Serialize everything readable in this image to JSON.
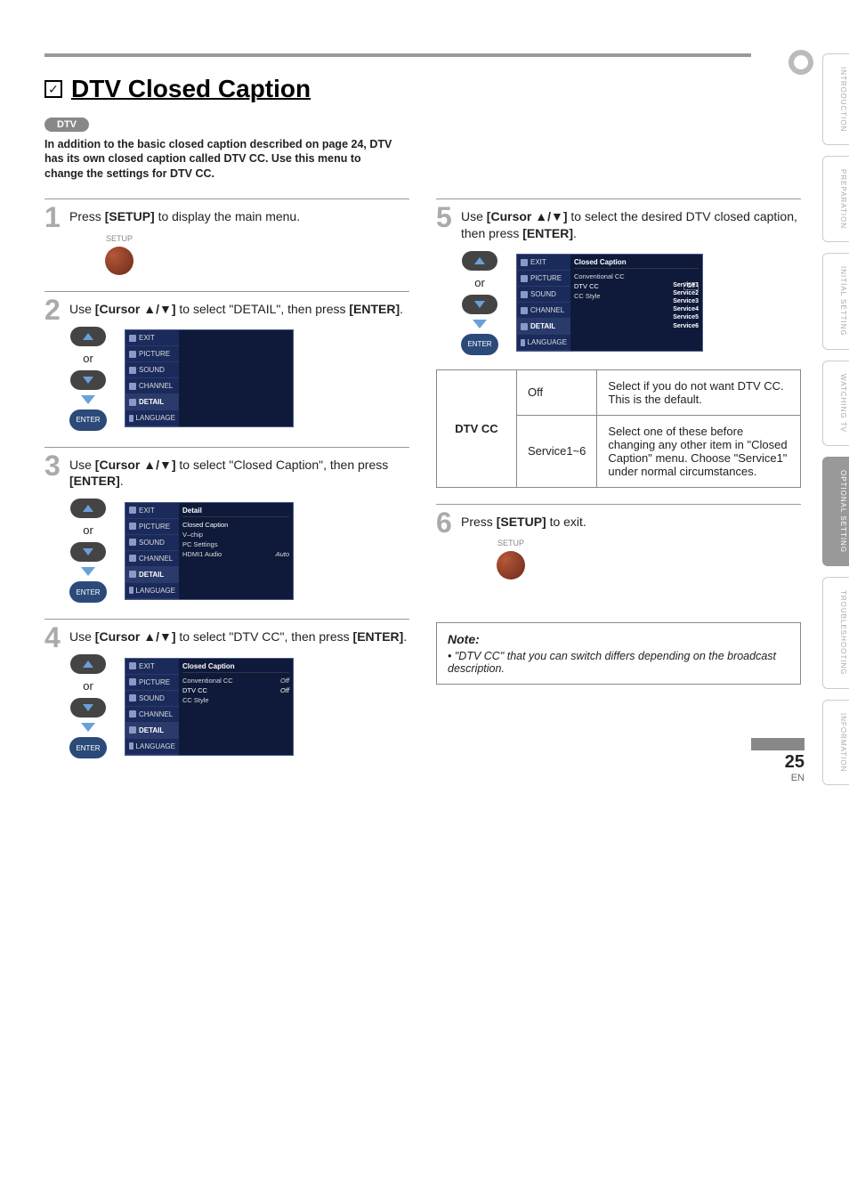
{
  "header": {
    "title": "DTV Closed Caption",
    "badge": "DTV",
    "intro": "In addition to the basic closed caption described on page 24, DTV has its own closed caption called DTV CC. Use this menu to change the settings for DTV CC."
  },
  "steps": {
    "s1": {
      "num": "1",
      "text_pre": "Press ",
      "text_bold": "[SETUP]",
      "text_post": " to display the main menu.",
      "setup_label": "SETUP"
    },
    "s2": {
      "num": "2",
      "text_pre": "Use ",
      "text_bold": "[Cursor ▲/▼]",
      "text_mid": " to select \"DETAIL\", then press ",
      "text_bold2": "[ENTER]",
      "text_end": ".",
      "or": "or",
      "enter": "ENTER"
    },
    "s3": {
      "num": "3",
      "text_pre": "Use ",
      "text_bold": "[Cursor ▲/▼]",
      "text_mid": " to select \"Closed Caption\", then press ",
      "text_bold2": "[ENTER]",
      "text_end": ".",
      "or": "or",
      "enter": "ENTER"
    },
    "s4": {
      "num": "4",
      "text_pre": "Use ",
      "text_bold": "[Cursor ▲/▼]",
      "text_mid": " to select \"DTV CC\", then press ",
      "text_bold2": "[ENTER]",
      "text_end": ".",
      "or": "or",
      "enter": "ENTER"
    },
    "s5": {
      "num": "5",
      "text_pre": "Use ",
      "text_bold": "[Cursor ▲/▼]",
      "text_mid": " to select the desired DTV closed caption, then press ",
      "text_bold2": "[ENTER]",
      "text_end": ".",
      "or": "or",
      "enter": "ENTER"
    },
    "s6": {
      "num": "6",
      "text_pre": "Press ",
      "text_bold": "[SETUP]",
      "text_post": " to exit.",
      "setup_label": "SETUP"
    }
  },
  "osd_tabs": {
    "exit": "EXIT",
    "picture": "PICTURE",
    "sound": "SOUND",
    "channel": "CHANNEL",
    "detail": "DETAIL",
    "language": "LANGUAGE"
  },
  "osd3": {
    "header": "Detail",
    "items": [
      {
        "label": "Closed Caption",
        "val": ""
      },
      {
        "label": "V–chip",
        "val": ""
      },
      {
        "label": "PC Settings",
        "val": ""
      },
      {
        "label": "HDMI1 Audio",
        "val": "Auto"
      }
    ]
  },
  "osd4": {
    "header": "Closed Caption",
    "items": [
      {
        "label": "Conventional CC",
        "val": "Off"
      },
      {
        "label": "DTV CC",
        "val": "Off"
      },
      {
        "label": "CC Style",
        "val": ""
      }
    ]
  },
  "osd5": {
    "header": "Closed Caption",
    "items": [
      {
        "label": "Conventional CC",
        "val": ""
      },
      {
        "label": "DTV CC",
        "val": "Off"
      },
      {
        "label": "CC Style",
        "val": ""
      }
    ],
    "services": [
      "Service1",
      "Service2",
      "Service3",
      "Service4",
      "Service5",
      "Service6"
    ]
  },
  "option_table": {
    "header": "DTV CC",
    "rows": [
      {
        "opt": "Off",
        "desc": "Select if you do not want DTV CC. This is the default."
      },
      {
        "opt": "Service1~6",
        "desc": "Select one of these before changing any other item in \"Closed Caption\" menu. Choose \"Service1\" under normal circumstances."
      }
    ]
  },
  "note": {
    "title": "Note:",
    "item": "\"DTV CC\" that you can switch differs depending on the broadcast description."
  },
  "side_nav": [
    "INTRODUCTION",
    "PREPARATION",
    "INITIAL SETTING",
    "WATCHING TV",
    "OPTIONAL SETTING",
    "TROUBLESHOOTING",
    "INFORMATION"
  ],
  "footer": {
    "page": "25",
    "lang": "EN"
  }
}
